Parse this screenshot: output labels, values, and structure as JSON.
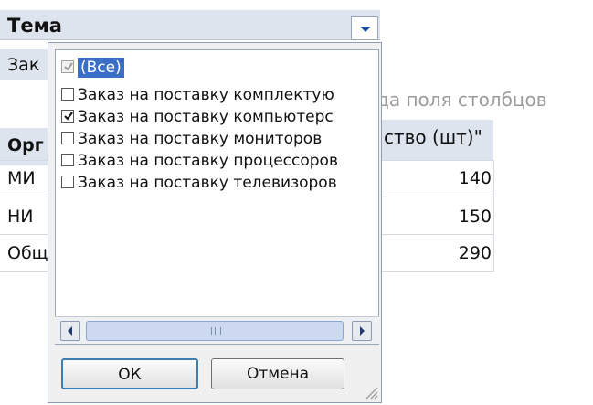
{
  "pivot": {
    "field_header": "Тема",
    "filter_value": "Зак",
    "column_drop_hint": "да поля столбцов",
    "row_header": "Орг",
    "column_header": "ство (шт)\"",
    "rows": [
      {
        "label": "МИ",
        "value": "140"
      },
      {
        "label": "НИ",
        "value": "150"
      },
      {
        "label": "Общ",
        "value": "290"
      }
    ]
  },
  "filter_popup": {
    "items": [
      {
        "label": "(Все)",
        "checked": true,
        "disabled": true,
        "selected": true
      },
      {
        "label": "Заказ на поставку комплектую",
        "checked": false
      },
      {
        "label": "Заказ на поставку компьютерс",
        "checked": true
      },
      {
        "label": "Заказ на поставку мониторов",
        "checked": false
      },
      {
        "label": "Заказ на поставку процессоров",
        "checked": false
      },
      {
        "label": "Заказ на поставку телевизоров",
        "checked": false
      }
    ],
    "ok_label": "ОК",
    "cancel_label": "Отмена"
  },
  "colors": {
    "header_bg": "#dde4ee",
    "selection": "#3b6fc7",
    "ok_border": "#3c7fb1"
  }
}
